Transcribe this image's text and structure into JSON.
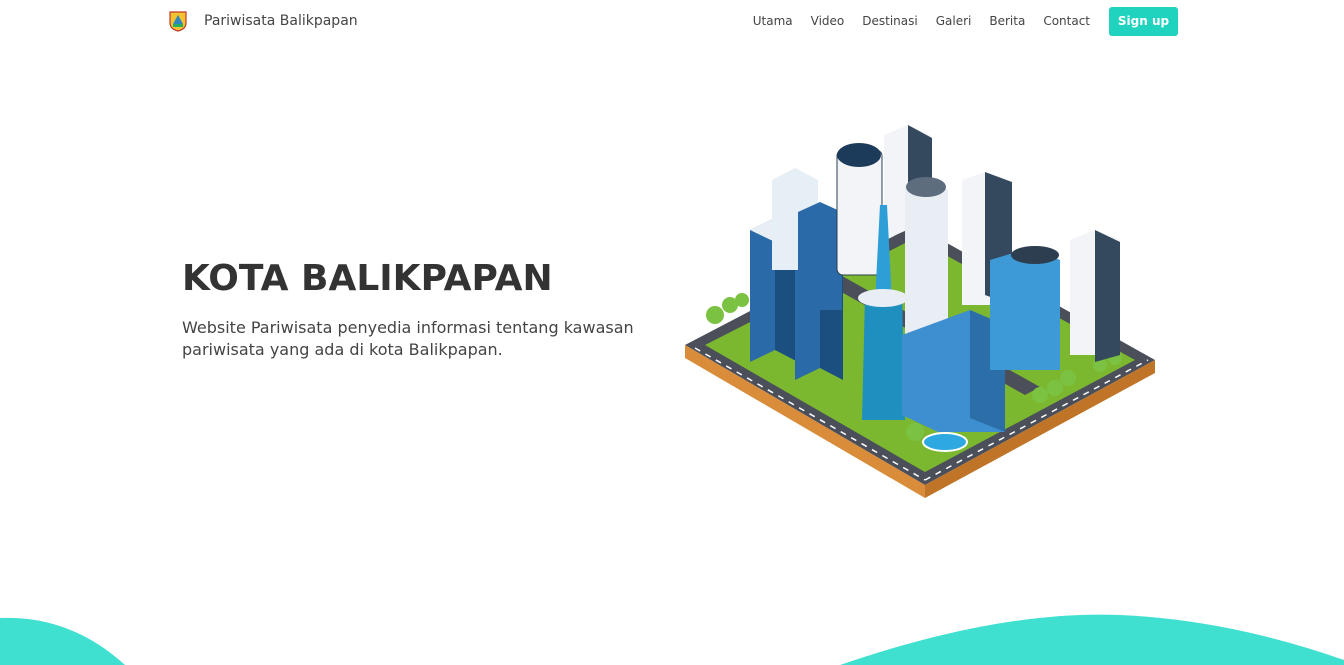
{
  "navbar": {
    "brand_name": "Pariwisata Balikpapan",
    "logo_icon": "city-emblem-icon",
    "links": [
      "Utama",
      "Video",
      "Destinasi",
      "Galeri",
      "Berita",
      "Contact"
    ],
    "signup_label": "Sign up",
    "accent_color": "#1fd3be"
  },
  "hero": {
    "title": "KOTA BALIKPAPAN",
    "subtitle": "Website Pariwisata penyedia informasi tentang kawasan pariwisata yang ada di kota Balikpapan.",
    "illustration": "isometric-city-icon"
  },
  "footer_wave_color": "#40e0d0"
}
